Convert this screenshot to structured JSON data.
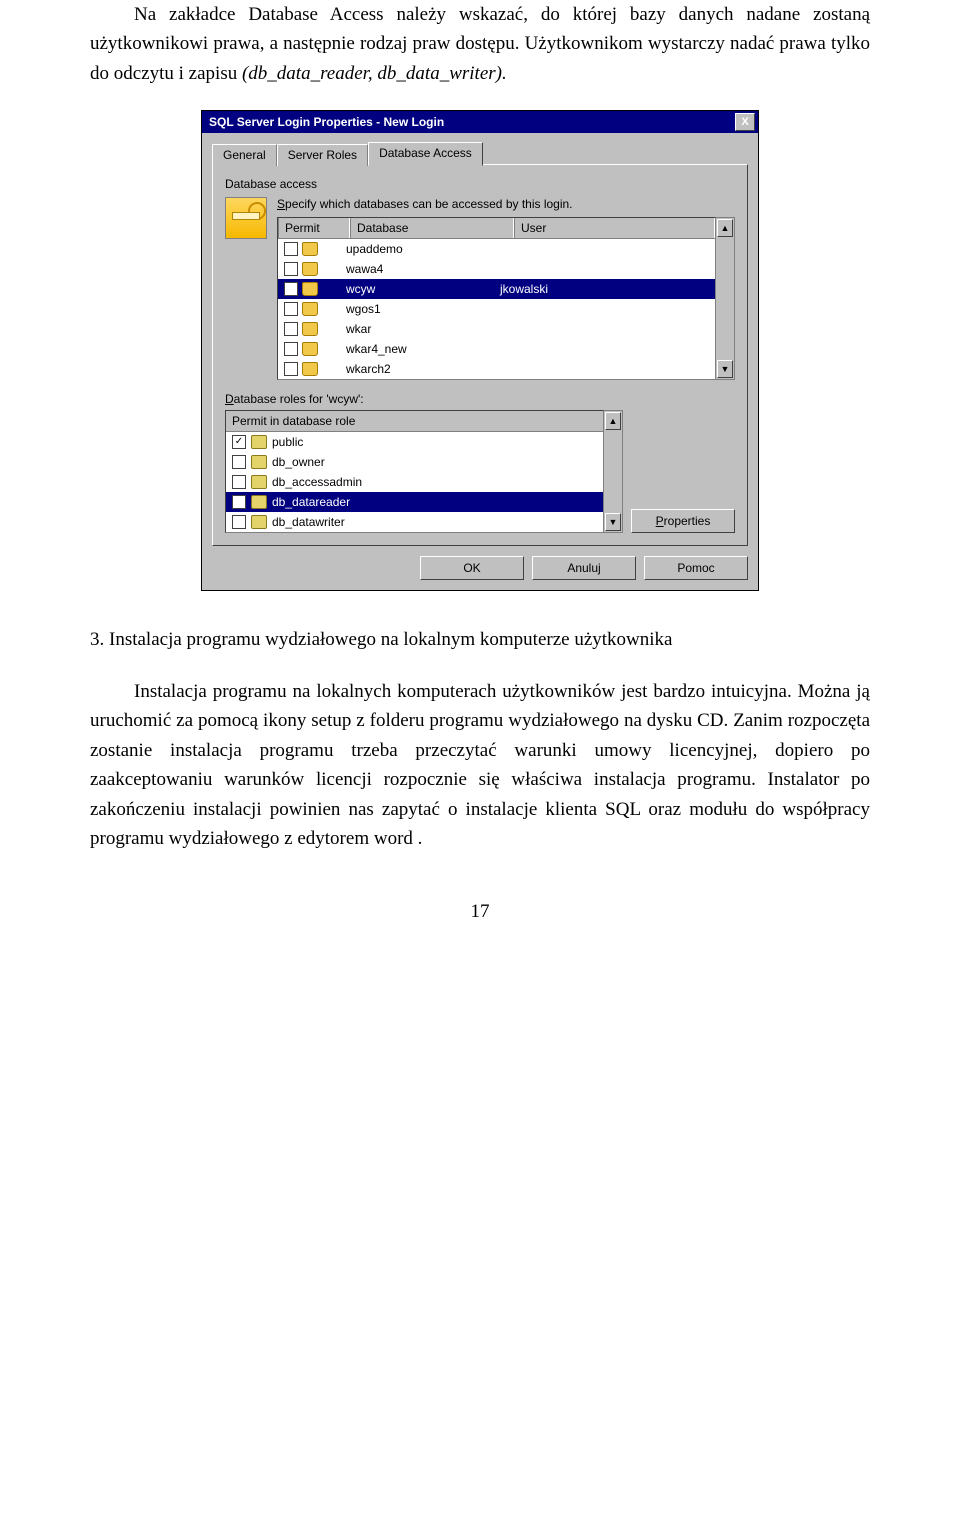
{
  "para1_a": "Na zakładce Database Access należy wskazać, do której bazy danych nadane zostaną użytkownikowi prawa, a następnie rodzaj praw dostępu. Użytkownikom wystarczy nadać prawa tylko do odczytu i zapisu ",
  "para1_b": "(db_data_reader, db_data_writer).",
  "heading": "3. Instalacja  programu wydziałowego na lokalnym komputerze  użytkownika",
  "para2": "Instalacja programu na lokalnych komputerach użytkowników jest bardzo intuicyjna. Można ją uruchomić za pomocą ikony setup z folderu programu wydziałowego na dysku CD. Zanim rozpoczęta zostanie instalacja programu trzeba przeczytać warunki umowy licencyjnej, dopiero po zaakceptowaniu warunków licencji rozpocznie się właściwa instalacja programu. Instalator po zakończeniu instalacji powinien nas zapytać o instalacje klienta  SQL oraz  modułu do współpracy programu wydziałowego z edytorem  word .",
  "pagenum": "17",
  "dialog": {
    "title": "SQL Server Login Properties - New Login",
    "tabs": {
      "general": "General",
      "server_roles": "Server Roles",
      "db_access": "Database Access"
    },
    "section_label": "Database access",
    "specify_pre": "S",
    "specify_rest": "pecify which databases can be accessed by this login.",
    "cols": {
      "permit": "Permit",
      "database": "Database",
      "user": "User"
    },
    "rows": [
      {
        "checked": false,
        "db": "upaddemo",
        "user": ""
      },
      {
        "checked": false,
        "db": "wawa4",
        "user": ""
      },
      {
        "checked": true,
        "db": "wcyw",
        "user": "jkowalski",
        "selected": true
      },
      {
        "checked": false,
        "db": "wgos1",
        "user": ""
      },
      {
        "checked": false,
        "db": "wkar",
        "user": ""
      },
      {
        "checked": false,
        "db": "wkar4_new",
        "user": ""
      },
      {
        "checked": false,
        "db": "wkarch2",
        "user": ""
      }
    ],
    "roles_label_pre": "D",
    "roles_label_rest": "atabase roles for 'wcyw':",
    "roles_header": "Permit in database role",
    "roles": [
      {
        "checked": true,
        "name": "public"
      },
      {
        "checked": false,
        "name": "db_owner"
      },
      {
        "checked": false,
        "name": "db_accessadmin"
      },
      {
        "checked": true,
        "name": "db_datareader",
        "selected": true
      },
      {
        "checked": false,
        "name": "db_datawriter"
      }
    ],
    "buttons": {
      "properties": "Properties",
      "ok": "OK",
      "cancel": "Anuluj",
      "help": "Pomoc"
    },
    "arrows": {
      "up": "▲",
      "down": "▼"
    },
    "close": "X"
  }
}
